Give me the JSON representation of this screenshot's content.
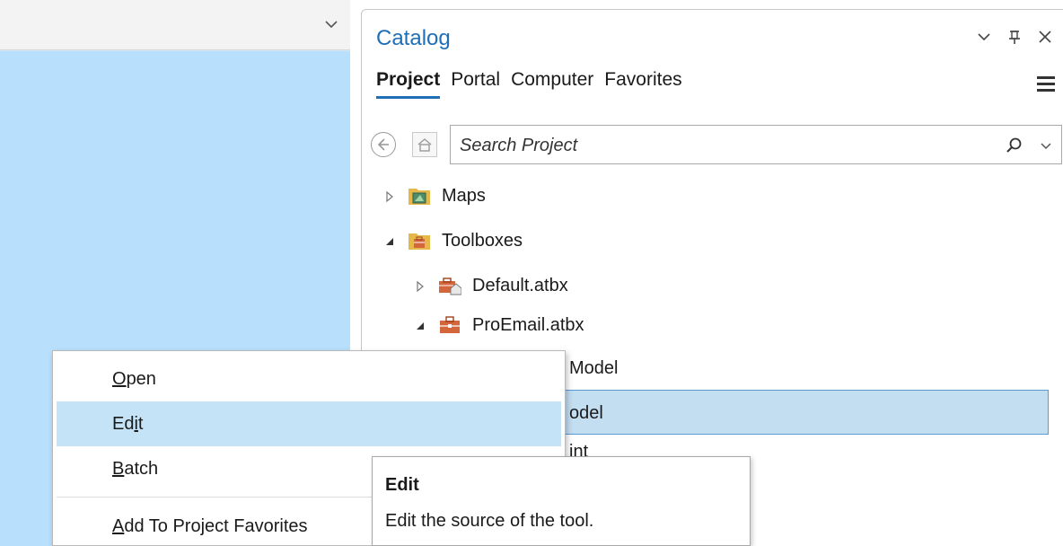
{
  "catalog": {
    "title": "Catalog",
    "tabs": [
      {
        "label": "Project",
        "active": true
      },
      {
        "label": "Portal",
        "active": false
      },
      {
        "label": "Computer",
        "active": false
      },
      {
        "label": "Favorites",
        "active": false
      }
    ],
    "search": {
      "placeholder": "Search Project"
    },
    "tree": [
      {
        "label": "Maps",
        "expanded": false,
        "icon": "maps-folder-icon"
      },
      {
        "label": "Toolboxes",
        "expanded": true,
        "icon": "toolboxes-folder-icon"
      },
      {
        "label": "Default.atbx",
        "expanded": false,
        "icon": "default-toolbox-icon"
      },
      {
        "label": "ProEmail.atbx",
        "expanded": true,
        "icon": "toolbox-icon"
      },
      {
        "label": "Model",
        "icon": "model-icon"
      },
      {
        "label": "odel",
        "icon": "model-icon",
        "selected": true
      },
      {
        "label": "int",
        "icon": "script-icon"
      }
    ]
  },
  "context_menu": {
    "items": [
      {
        "label": "Open",
        "mnemonic": "O"
      },
      {
        "label": "Edit",
        "mnemonic": "i",
        "highlighted": true
      },
      {
        "label": "Batch",
        "mnemonic": "B"
      },
      {
        "label": "Add To Project Favorites",
        "mnemonic": "A"
      }
    ]
  },
  "tooltip": {
    "title": "Edit",
    "description": "Edit the source of the tool."
  },
  "colors": {
    "accent": "#1f6fb7",
    "map_background": "#b8dffb",
    "menu_highlight": "#c5e3f7",
    "selection": "#c3ddf1"
  }
}
